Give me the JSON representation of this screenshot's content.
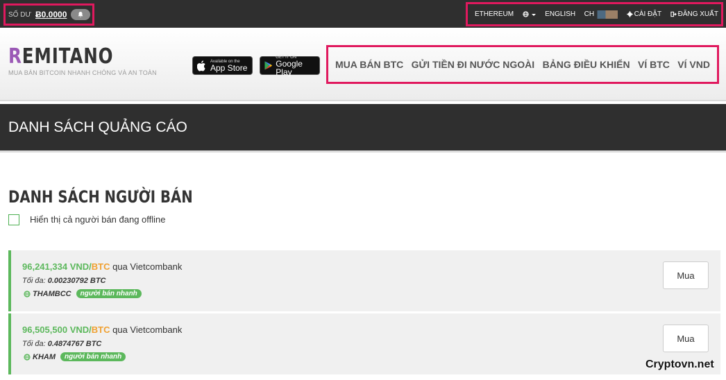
{
  "topbar": {
    "balance_label": "SỐ DƯ",
    "balance_value": "Ƀ0.0000",
    "nav": [
      "ETHEREUM",
      "ENGLISH",
      "CH",
      "CÀI ĐẶT",
      "ĐĂNG XUẤT"
    ]
  },
  "header": {
    "logo_first": "R",
    "logo_rest": "EMITANO",
    "tagline": "MUA BÁN BITCOIN NHANH CHÓNG VÀ AN TOÀN",
    "appstore_small": "Available on the",
    "appstore_big": "App Store",
    "googleplay_small": "GET IT ON",
    "googleplay_big": "Google Play",
    "nav": [
      "MUA BÁN BTC",
      "GỬI TIỀN ĐI NƯỚC NGOÀI",
      "BẢNG ĐIỀU KHIỂN",
      "VÍ BTC",
      "VÍ VND"
    ]
  },
  "page_title": "DANH SÁCH QUẢNG CÁO",
  "sellers": {
    "title": "DANH SÁCH NGƯỜI BÁN",
    "offline_label": "Hiển thị cả người bán đang offline",
    "items": [
      {
        "price": "96,241,334",
        "vnd": "VND",
        "slash": "/",
        "btc": "BTC",
        "via": "qua Vietcombank",
        "limit_label": "Tối đa:",
        "limit_value": "0.00230792 BTC",
        "seller": "THAMBCC",
        "badge": "người bán nhanh",
        "buy": "Mua"
      },
      {
        "price": "96,505,500",
        "vnd": "VND",
        "slash": "/",
        "btc": "BTC",
        "via": "qua Vietcombank",
        "limit_label": "Tối đa:",
        "limit_value": "0.4874767 BTC",
        "seller": "KHAM",
        "badge": "người bán nhanh",
        "buy": "Mua"
      }
    ]
  },
  "watermark": "Cryptovn.net",
  "colors": {
    "highlight": "#e0195e",
    "accent_green": "#5cb85c",
    "btc_orange": "#f0a030",
    "dark_bar": "#2f2f2f"
  }
}
